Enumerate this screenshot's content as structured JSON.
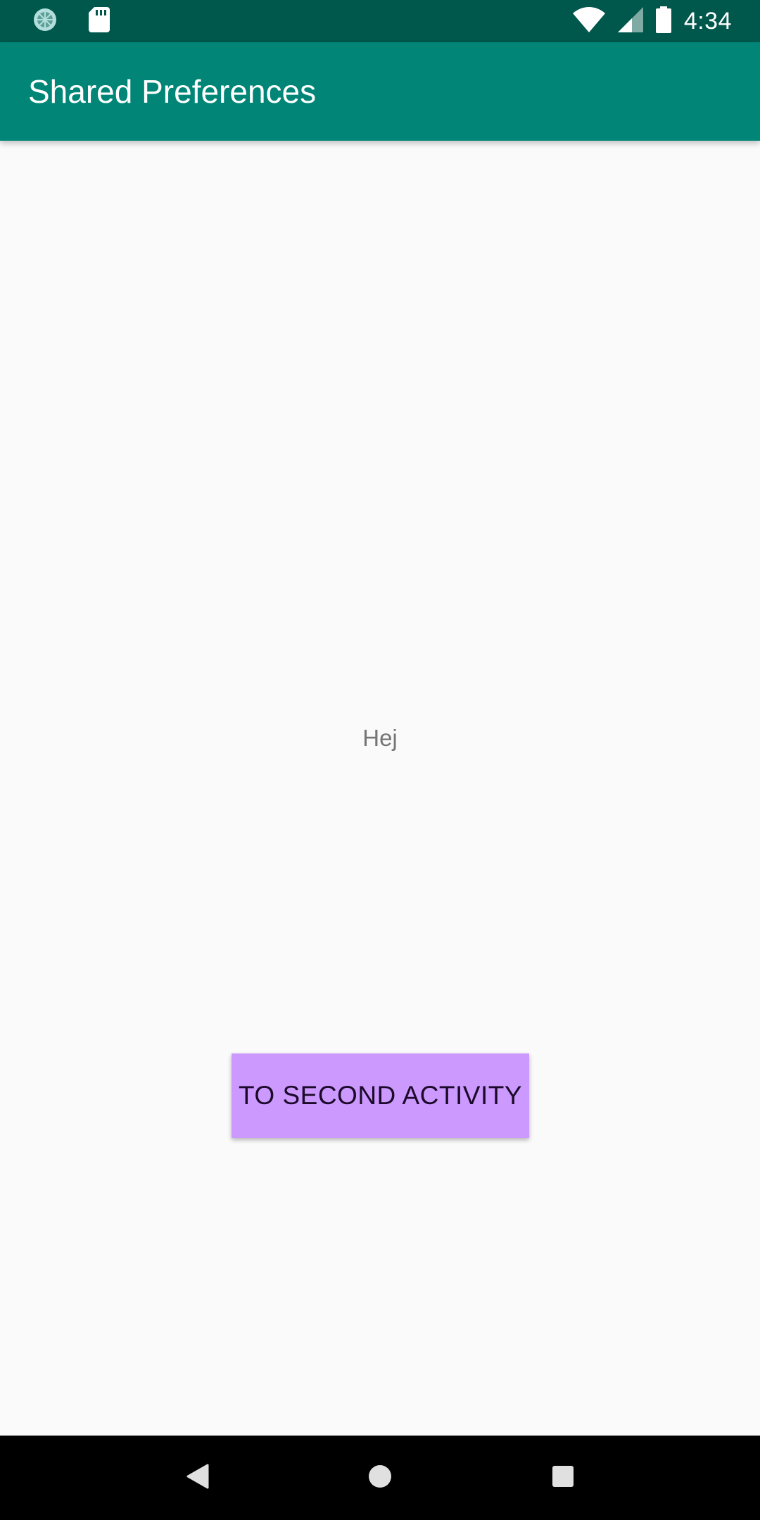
{
  "status_bar": {
    "time": "4:34",
    "icons": [
      "sync-indicator-icon",
      "sd-card-icon",
      "wifi-icon",
      "cellular-signal-icon",
      "battery-icon"
    ]
  },
  "app_bar": {
    "title": "Shared Preferences",
    "color": "#008577"
  },
  "main": {
    "text": "Hej",
    "button_label": "TO SECOND ACTIVITY",
    "button_color": "#cc99ff"
  },
  "nav_bar": {
    "icons": [
      "back-icon",
      "home-icon",
      "recents-icon"
    ]
  }
}
